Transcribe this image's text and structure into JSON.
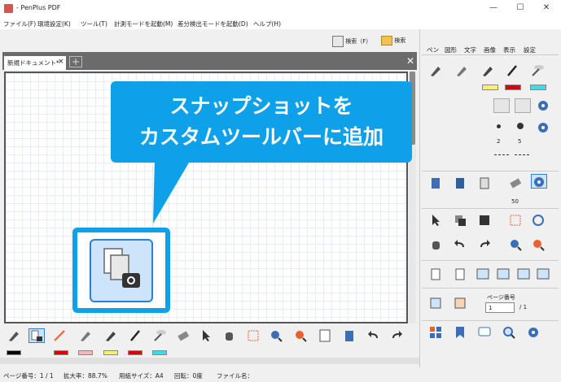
{
  "window": {
    "title": "- PenPlus PDF",
    "minimize": "—",
    "maximize": "☐",
    "close": "✕"
  },
  "menu": [
    "ファイル(F)",
    "環境設定(K)",
    "ツール(T)",
    "計測モードを起動(M)",
    "差分検出モードを起動(D)",
    "ヘルプ(H)"
  ],
  "search": {
    "left": "検索（F）",
    "right": "検索"
  },
  "tab": {
    "name": "新規ドキュメント*",
    "close": "×",
    "add": "+",
    "panel_close": "✕"
  },
  "callout": {
    "line1": "スナップショットを",
    "line2": "カスタムツールバーに追加"
  },
  "right_tabs": [
    "ペン",
    "図形",
    "文字",
    "画像",
    "表示",
    "設定"
  ],
  "right_labels": {
    "size1": "2",
    "size2": "5",
    "eraser_size": "50",
    "page_label": "ページ番号",
    "page_value": "1",
    "page_total": "/ 1"
  },
  "status": {
    "page": "ページ番号：1 / 1",
    "zoom": "拡大率：88.7%",
    "paper": "用紙サイズ：A4",
    "rotation": "回転：0度",
    "filename": "ファイル名："
  },
  "colors": {
    "accent": "#0ea0e8",
    "swatches": [
      "#000000",
      "#e00000",
      "#f4b8b8",
      "#f7f26a",
      "#e00000",
      "#33e0f0"
    ]
  }
}
